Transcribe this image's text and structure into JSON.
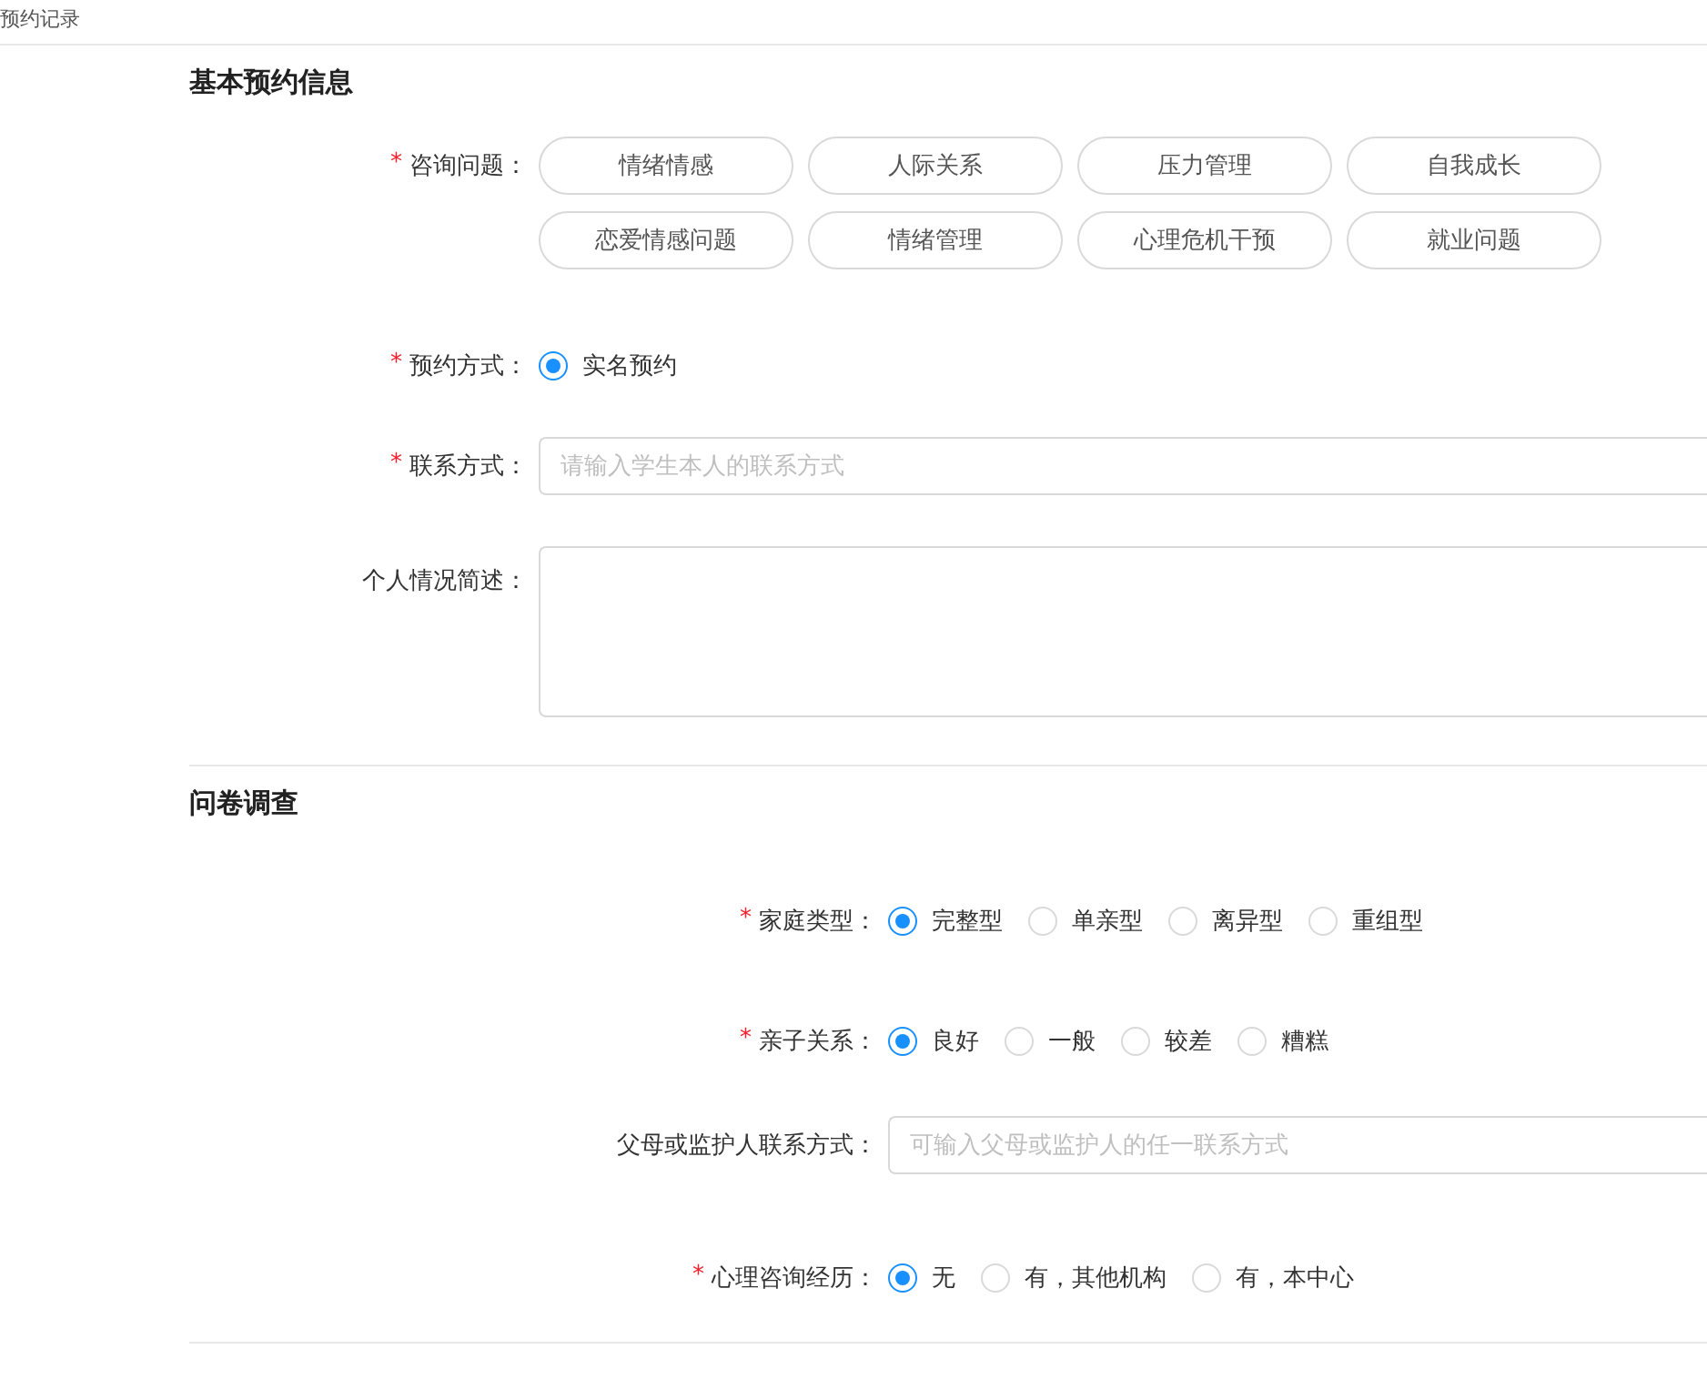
{
  "page_title": "预约记录",
  "sections": [
    {
      "title": "基本预约信息",
      "fields": [
        {
          "kind": "chips",
          "marker": "*",
          "label": "咨询问题：",
          "options": [
            {
              "label": "情绪情感",
              "selected": false
            },
            {
              "label": "人际关系",
              "selected": false
            },
            {
              "label": "压力管理",
              "selected": false
            },
            {
              "label": "自我成长",
              "selected": false
            },
            {
              "label": "恋爱情感问题",
              "selected": false
            },
            {
              "label": "情绪管理",
              "selected": false
            },
            {
              "label": "心理危机干预",
              "selected": false
            },
            {
              "label": "就业问题",
              "selected": false
            }
          ]
        },
        {
          "kind": "radio",
          "marker": "*",
          "label": "预约方式：",
          "options": [
            {
              "label": "实名预约",
              "selected": true
            }
          ]
        },
        {
          "kind": "input",
          "marker": "*",
          "label": "联系方式：",
          "placeholder": "请输入学生本人的联系方式"
        },
        {
          "kind": "textarea",
          "label": "个人情况简述："
        }
      ]
    },
    {
      "title": "问卷调查",
      "fields": [
        {
          "kind": "radio",
          "marker": "*",
          "label": "家庭类型：",
          "options": [
            {
              "label": "完整型",
              "selected": true
            },
            {
              "label": "单亲型",
              "selected": false
            },
            {
              "label": "离异型",
              "selected": false
            },
            {
              "label": "重组型",
              "selected": false
            }
          ]
        },
        {
          "kind": "radio",
          "marker": "*",
          "label": "亲子关系：",
          "options": [
            {
              "label": "良好",
              "selected": true
            },
            {
              "label": "一般",
              "selected": false
            },
            {
              "label": "较差",
              "selected": false
            },
            {
              "label": "糟糕",
              "selected": false
            }
          ]
        },
        {
          "kind": "input",
          "label": "父母或监护人联系方式：",
          "placeholder": "可输入父母或监护人的任一联系方式"
        },
        {
          "kind": "radio",
          "marker": "*",
          "label": "心理咨询经历：",
          "options": [
            {
              "label": "无",
              "selected": true
            },
            {
              "label": "有，其他机构",
              "selected": false
            },
            {
              "label": "有，本中心",
              "selected": false
            }
          ]
        }
      ]
    }
  ]
}
